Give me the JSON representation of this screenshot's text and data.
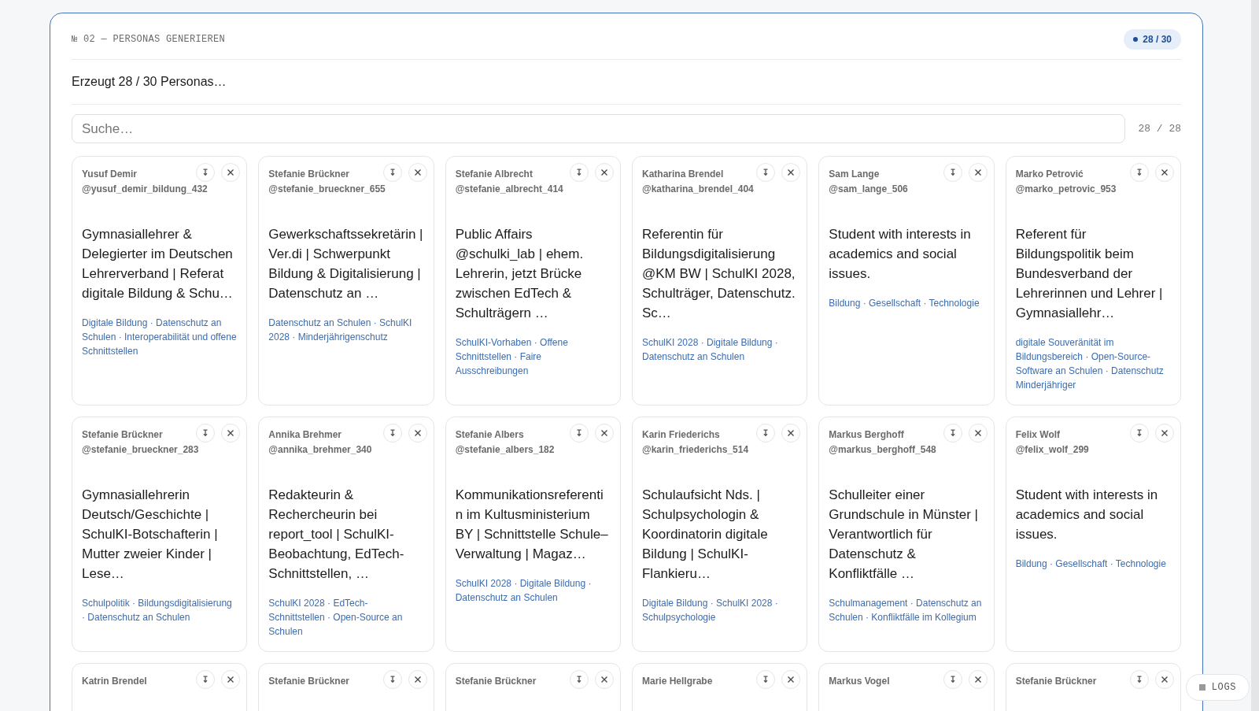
{
  "section": {
    "label": "№ 02 — PERSONAS GENERIEREN",
    "badge": "28 / 30"
  },
  "status": "Erzeugt 28 / 30 Personas…",
  "search": {
    "placeholder": "Suche…",
    "count": "28 / 28"
  },
  "personas": [
    {
      "name": "Yusuf Demir",
      "handle": "@yusuf_demir_bildung_432",
      "bio": "Gymnasiallehrer & Delegierter im Deutschen Lehrerverband | Referat digitale Bildung & Schu…",
      "tags": "Digitale Bildung · Datenschutz an Schulen · Interoperabilität und offene Schnittstellen"
    },
    {
      "name": "Stefanie Brückner",
      "handle": "@stefanie_brueckner_655",
      "bio": "Gewerkschaftssekretärin | Ver.di | Schwerpunkt Bildung & Digitalisierung | Datenschutz an …",
      "tags": "Datenschutz an Schulen · SchulKI 2028 · Minderjährigenschutz"
    },
    {
      "name": "Stefanie Albrecht",
      "handle": "@stefanie_albrecht_414",
      "bio": "Public Affairs @schulki_lab | ehem. Lehrerin, jetzt Brücke zwischen EdTech & Schulträgern …",
      "tags": "SchulKI-Vorhaben · Offene Schnittstellen · Faire Ausschreibungen"
    },
    {
      "name": "Katharina Brendel",
      "handle": "@katharina_brendel_404",
      "bio": "Referentin für Bildungsdigitalisierung @KM BW | SchulKI 2028, Schulträger, Datenschutz. Sc…",
      "tags": "SchulKI 2028 · Digitale Bildung · Datenschutz an Schulen"
    },
    {
      "name": "Sam Lange",
      "handle": "@sam_lange_506",
      "bio": "Student with interests in academics and social issues.",
      "tags": "Bildung · Gesellschaft · Technologie"
    },
    {
      "name": "Marko Petrović",
      "handle": "@marko_petrovic_953",
      "bio": "Referent für Bildungspolitik beim Bundesverband der Lehrerinnen und Lehrer | Gymnasiallehr…",
      "tags": "digitale Souveränität im Bildungsbereich · Open-Source-Software an Schulen · Datenschutz Minderjähriger"
    },
    {
      "name": "Stefanie Brückner",
      "handle": "@stefanie_brueckner_283",
      "bio": "Gymnasiallehrerin Deutsch/Geschichte | SchulKI-Botschafterin | Mutter zweier Kinder | Lese…",
      "tags": "Schulpolitik · Bildungsdigitalisierung · Datenschutz an Schulen"
    },
    {
      "name": "Annika Brehmer",
      "handle": "@annika_brehmer_340",
      "bio": "Redakteurin & Rechercheurin bei report_tool | SchulKI-Beobachtung, EdTech-Schnittstellen, …",
      "tags": "SchulKI 2028 · EdTech-Schnittstellen · Open-Source an Schulen"
    },
    {
      "name": "Stefanie Albers",
      "handle": "@stefanie_albers_182",
      "bio": "Kommunikationsreferentin im Kultusministerium BY | Schnittstelle Schule–Verwaltung | Magaz…",
      "tags": "SchulKI 2028 · Digitale Bildung · Datenschutz an Schulen"
    },
    {
      "name": "Karin Friederichs",
      "handle": "@karin_friederichs_514",
      "bio": "Schulaufsicht Nds. | Schulpsychologin & Koordinatorin digitale Bildung | SchulKI-Flankieru…",
      "tags": "Digitale Bildung · SchulKI 2028 · Schulpsychologie"
    },
    {
      "name": "Markus Berghoff",
      "handle": "@markus_berghoff_548",
      "bio": "Schulleiter einer Grundschule in Münster | Verantwortlich für Datenschutz & Konfliktfälle …",
      "tags": "Schulmanagement · Datenschutz an Schulen · Konfliktfälle im Kollegium"
    },
    {
      "name": "Felix Wolf",
      "handle": "@felix_wolf_299",
      "bio": "Student with interests in academics and social issues.",
      "tags": "Bildung · Gesellschaft · Technologie"
    },
    {
      "name": "Katrin Brendel"
    },
    {
      "name": "Stefanie Brückner"
    },
    {
      "name": "Stefanie Brückner"
    },
    {
      "name": "Marie Hellgrabe"
    },
    {
      "name": "Markus Vogel"
    },
    {
      "name": "Stefanie Brückner"
    }
  ],
  "logs_button": "LOGS"
}
